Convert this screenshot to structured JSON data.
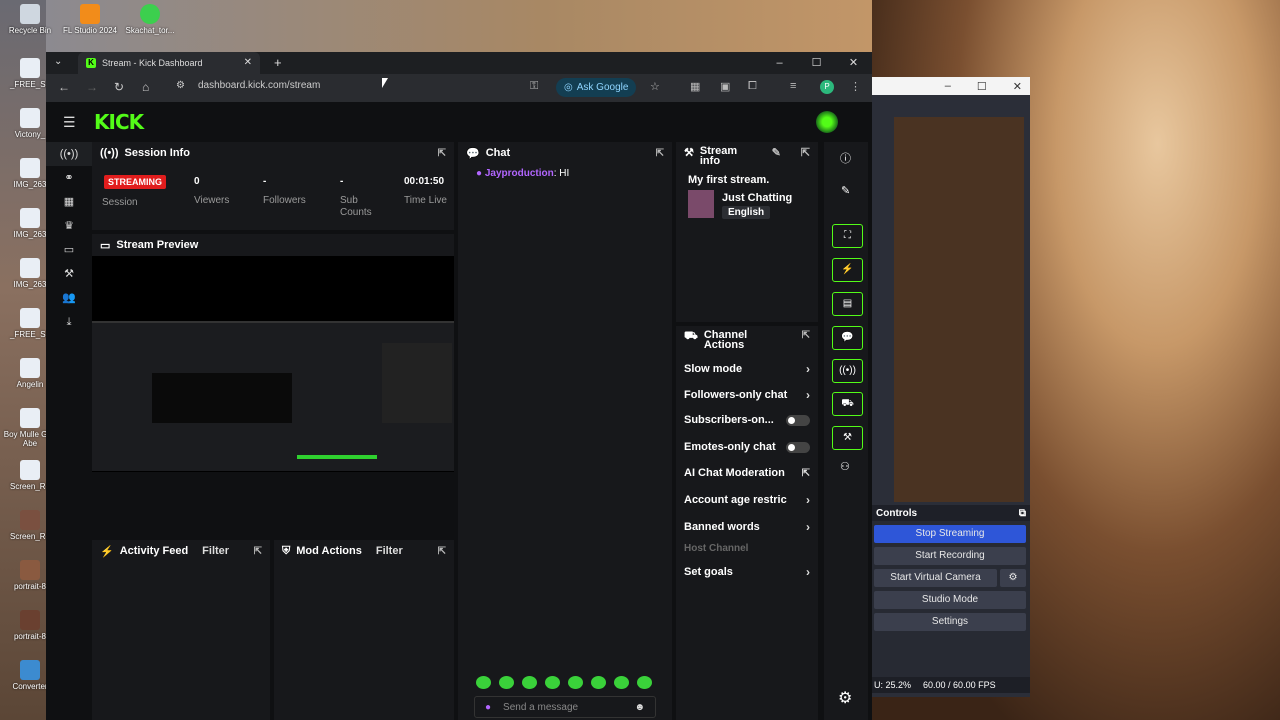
{
  "desktop": {
    "icons": [
      {
        "label": "Recycle Bin"
      },
      {
        "label": "FL Studio 2024"
      },
      {
        "label": "Skachat_tor..."
      },
      {
        "label": "_FREE_Sp"
      },
      {
        "label": "Victony_"
      },
      {
        "label": "IMG_263"
      },
      {
        "label": "IMG_263"
      },
      {
        "label": "IMG_263"
      },
      {
        "label": "_FREE_Sp"
      },
      {
        "label": "Angelin"
      },
      {
        "label": "Boy Mulle God Abe"
      },
      {
        "label": "Screen_Re"
      },
      {
        "label": "Screen_Re"
      },
      {
        "label": "portrait-8"
      },
      {
        "label": "portrait-8"
      },
      {
        "label": "Converter"
      }
    ]
  },
  "browser": {
    "tab_title": "Stream - Kick Dashboard",
    "url": "dashboard.kick.com/stream",
    "ask_google": "Ask Google",
    "profile_initial": "P"
  },
  "kick": {
    "logo": "KICK",
    "session_info": {
      "title": "Session Info",
      "badge": "STREAMING",
      "session_label": "Session",
      "stats": [
        {
          "value": "0",
          "label": "Viewers"
        },
        {
          "value": "-",
          "label": "Followers"
        },
        {
          "value": "-",
          "label": "Sub Counts"
        },
        {
          "value": "00:01:50",
          "label": "Time Live"
        }
      ]
    },
    "preview_title": "Stream Preview",
    "chat": {
      "title": "Chat",
      "messages": [
        {
          "user": "Jayproduction",
          "text": ": HI"
        }
      ],
      "placeholder": "Send a message"
    },
    "stream_info": {
      "title": "Stream info",
      "stream_title": "My first stream.",
      "category": "Just Chatting",
      "language": "English"
    },
    "channel_actions": {
      "title": "Channel Actions",
      "items": [
        {
          "label": "Slow mode"
        },
        {
          "label": "Followers-only chat"
        },
        {
          "label": "Subscribers-on..."
        },
        {
          "label": "Emotes-only chat"
        },
        {
          "label": "AI Chat Moderation"
        },
        {
          "label": "Account age restric"
        },
        {
          "label": "Banned words"
        },
        {
          "label": "Host Channel"
        },
        {
          "label": "Set goals"
        }
      ]
    },
    "activity_feed": {
      "title": "Activity Feed",
      "filter": "Filter"
    },
    "mod_actions": {
      "title": "Mod Actions",
      "filter": "Filter"
    }
  },
  "obs": {
    "controls_title": "Controls",
    "buttons": [
      "Stop Streaming",
      "Start Recording",
      "Start Virtual Camera",
      "Studio Mode",
      "Settings"
    ],
    "status_cpu": "U: 25.2%",
    "status_fps": "60.00 / 60.00 FPS",
    "colors": {
      "stop_streaming": "#2e56d8"
    }
  },
  "colors": {
    "kick_green": "#53fc18",
    "live_red": "#e11d1d",
    "chat_user": "#b266ff"
  }
}
